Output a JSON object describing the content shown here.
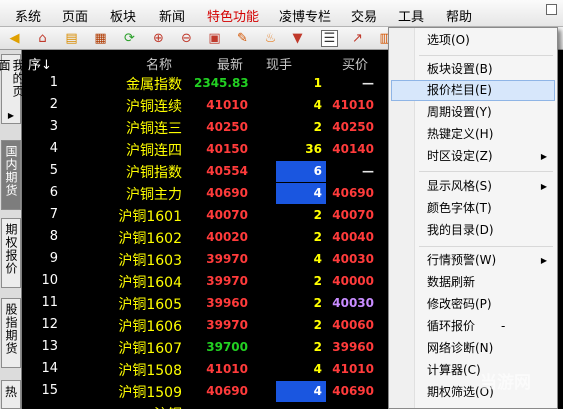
{
  "menu": [
    "系统",
    "页面",
    "板块",
    "新闻",
    "特色功能",
    "凌博专栏",
    "交易",
    "工具",
    "帮助"
  ],
  "left_tabs": [
    "我的页面",
    "国内期货",
    "期权报价",
    "股指期货",
    "热"
  ],
  "columns": {
    "no": "序↓",
    "name": "名称",
    "latest": "最新",
    "volume": "现手",
    "bid": "买价"
  },
  "rows": [
    {
      "no": "1",
      "name": "金属指数",
      "latest": "2345.83",
      "volume": "1",
      "bid": "—"
    },
    {
      "no": "2",
      "name": "沪铜连续",
      "latest": "41010",
      "volume": "4",
      "bid": "41010"
    },
    {
      "no": "3",
      "name": "沪铜连三",
      "latest": "40250",
      "volume": "2",
      "bid": "40250"
    },
    {
      "no": "4",
      "name": "沪铜连四",
      "latest": "40150",
      "volume": "36",
      "bid": "40140"
    },
    {
      "no": "5",
      "name": "沪铜指数",
      "latest": "40554",
      "volume": "6",
      "bid": "—"
    },
    {
      "no": "6",
      "name": "沪铜主力",
      "latest": "40690",
      "volume": "4",
      "bid": "40690"
    },
    {
      "no": "7",
      "name": "沪铜1601",
      "latest": "40070",
      "volume": "2",
      "bid": "40070"
    },
    {
      "no": "8",
      "name": "沪铜1602",
      "latest": "40020",
      "volume": "2",
      "bid": "40040"
    },
    {
      "no": "9",
      "name": "沪铜1603",
      "latest": "39970",
      "volume": "4",
      "bid": "40030"
    },
    {
      "no": "10",
      "name": "沪铜1604",
      "latest": "39970",
      "volume": "2",
      "bid": "40000"
    },
    {
      "no": "11",
      "name": "沪铜1605",
      "latest": "39960",
      "volume": "2",
      "bid": "40030"
    },
    {
      "no": "12",
      "name": "沪铜1606",
      "latest": "39970",
      "volume": "2",
      "bid": "40060"
    },
    {
      "no": "13",
      "name": "沪铜1607",
      "latest": "39700",
      "volume": "2",
      "bid": "39960"
    },
    {
      "no": "14",
      "name": "沪铜1508",
      "latest": "41010",
      "volume": "4",
      "bid": "41010"
    },
    {
      "no": "15",
      "name": "沪铜1509",
      "latest": "40690",
      "volume": "4",
      "bid": "40690"
    }
  ],
  "partial_row_name": "沪铜",
  "context_menu": [
    {
      "label": "选项(O)",
      "submenu": false
    },
    {
      "label": "板块设置(B)",
      "submenu": false
    },
    {
      "label": "报价栏目(E)",
      "submenu": false
    },
    {
      "label": "周期设置(Y)",
      "submenu": false
    },
    {
      "label": "热键定义(H)",
      "submenu": false
    },
    {
      "label": "时区设定(Z)",
      "submenu": true
    },
    {
      "label": "显示风格(S)",
      "submenu": true
    },
    {
      "label": "颜色字体(T)",
      "submenu": false
    },
    {
      "label": "我的目录(D)",
      "submenu": false
    },
    {
      "label": "行情预警(W)",
      "submenu": true
    },
    {
      "label": "数据刷新",
      "submenu": false
    },
    {
      "label": "修改密码(P)",
      "submenu": false
    },
    {
      "label": "循环报价",
      "submenu": false
    },
    {
      "label": "网络诊断(N)",
      "submenu": false
    },
    {
      "label": "计算器(C)",
      "submenu": false
    },
    {
      "label": "期权筛选(O)",
      "submenu": false
    }
  ],
  "loop_quote_suffix": "-",
  "watermark": "当游网",
  "colors": {
    "up": "#ff3b3b",
    "down": "#22d022",
    "name": "#ffff00",
    "selection": "#1a56e0"
  }
}
